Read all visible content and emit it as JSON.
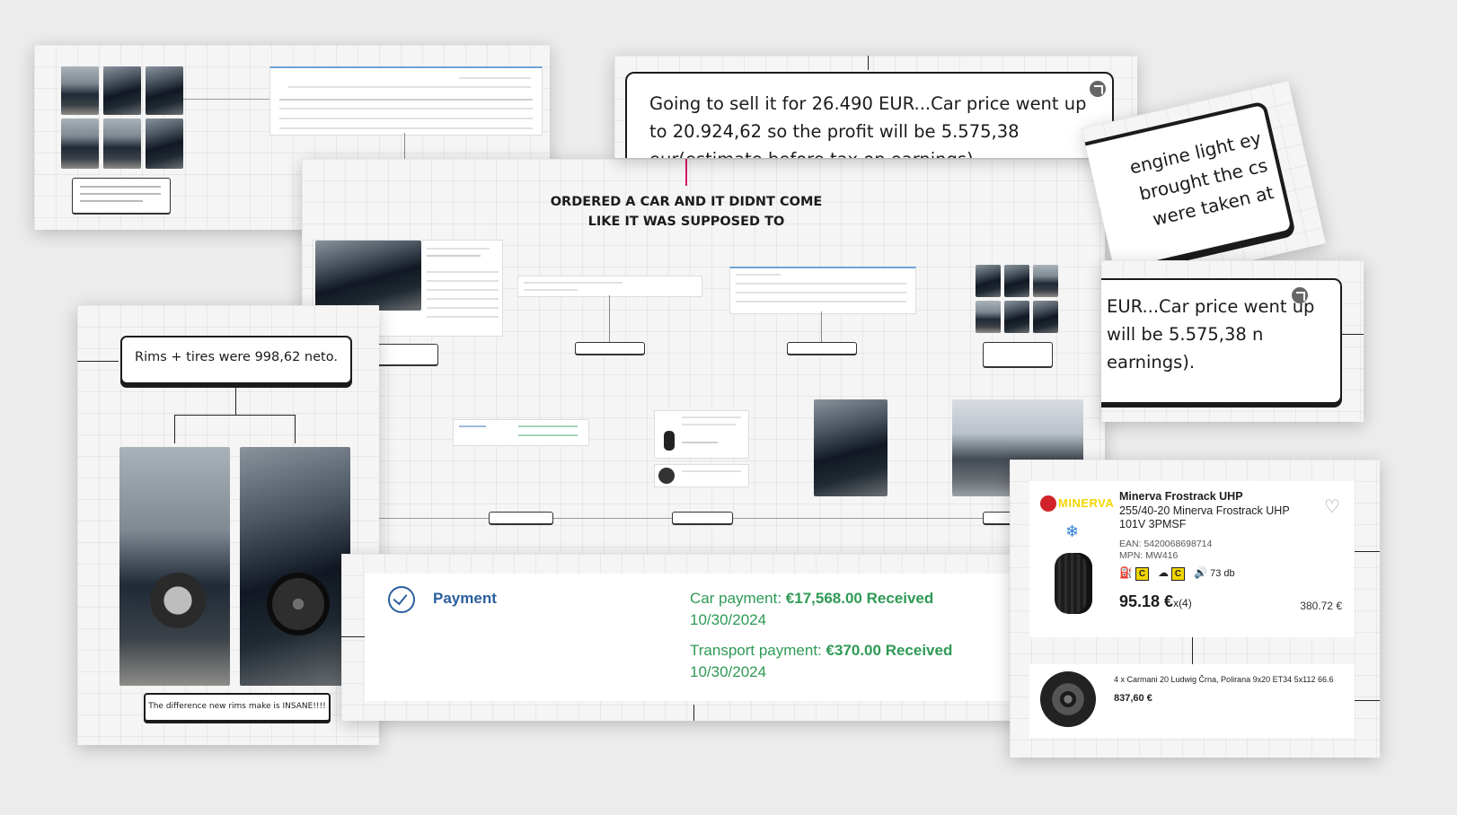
{
  "headline": "ORDERED A CAR AND IT DIDNT COME LIKE IT WAS SUPPOSED TO",
  "profit_note": "Going to sell it for 26.490 EUR...Car price went up to 20.924,62 so the profit will be 5.575,38 eur(estimate before tax on earnings).",
  "profit_note_crop": "EUR...Car price went up will be 5.575,38 n earnings).",
  "engine_note_crop": "engine light ey brought the cs were taken at",
  "rims_note": "Rims + tires were 998,62 neto.",
  "rims_caption": "The difference new rims make is INSANE!!!!",
  "payment": {
    "title": "Payment",
    "car_label": "Car payment:",
    "car_value": "€17,568.00 Received",
    "car_date": "10/30/2024",
    "transport_label": "Transport payment:",
    "transport_value": "€370.00 Received",
    "transport_date": "10/30/2024"
  },
  "tire": {
    "brand": "MINERVA",
    "title": "Minerva Frostrack UHP",
    "subtitle": "255/40-20 Minerva Frostrack UHP 101V 3PMSF",
    "ean": "EAN: 5420068698714",
    "mpn": "MPN: MW416",
    "fuel_grade": "C",
    "wet_grade": "C",
    "noise": "73 db",
    "price": "95.18 €",
    "qty": "x(4)",
    "total": "380.72 €"
  },
  "rims": {
    "title": "4 x Carmani 20 Ludwig Črna, Polirana 9x20 ET34 5x112 66.6",
    "price": "837,60 €"
  },
  "colors": {
    "payment_blue": "#2a5f9e",
    "payment_green": "#2e9a55",
    "brand_red": "#d2232a",
    "brand_yellow": "#f2d600"
  }
}
